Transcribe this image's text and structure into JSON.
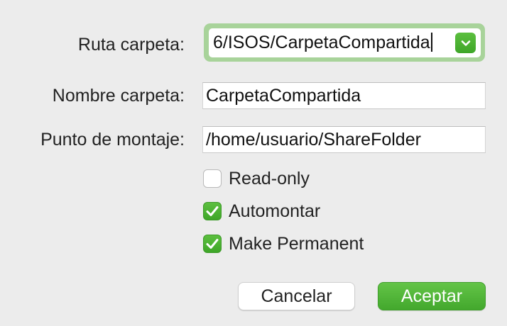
{
  "form": {
    "folder_path": {
      "label": "Ruta carpeta:",
      "value": "6/ISOS/CarpetaCompartida",
      "dropdown_icon": "chevron-down-icon"
    },
    "folder_name": {
      "label": "Nombre carpeta:",
      "value": "CarpetaCompartida"
    },
    "mount_point": {
      "label": "Punto de montaje:",
      "value": "/home/usuario/ShareFolder"
    },
    "options": [
      {
        "label": "Read-only",
        "checked": false
      },
      {
        "label": "Automontar",
        "checked": true
      },
      {
        "label": "Make Permanent",
        "checked": true
      }
    ]
  },
  "buttons": {
    "cancel_label": "Cancelar",
    "accept_label": "Aceptar"
  },
  "colors": {
    "accent": "#4caf34",
    "focus_ring": "#a8d39a",
    "background": "#ececec"
  }
}
